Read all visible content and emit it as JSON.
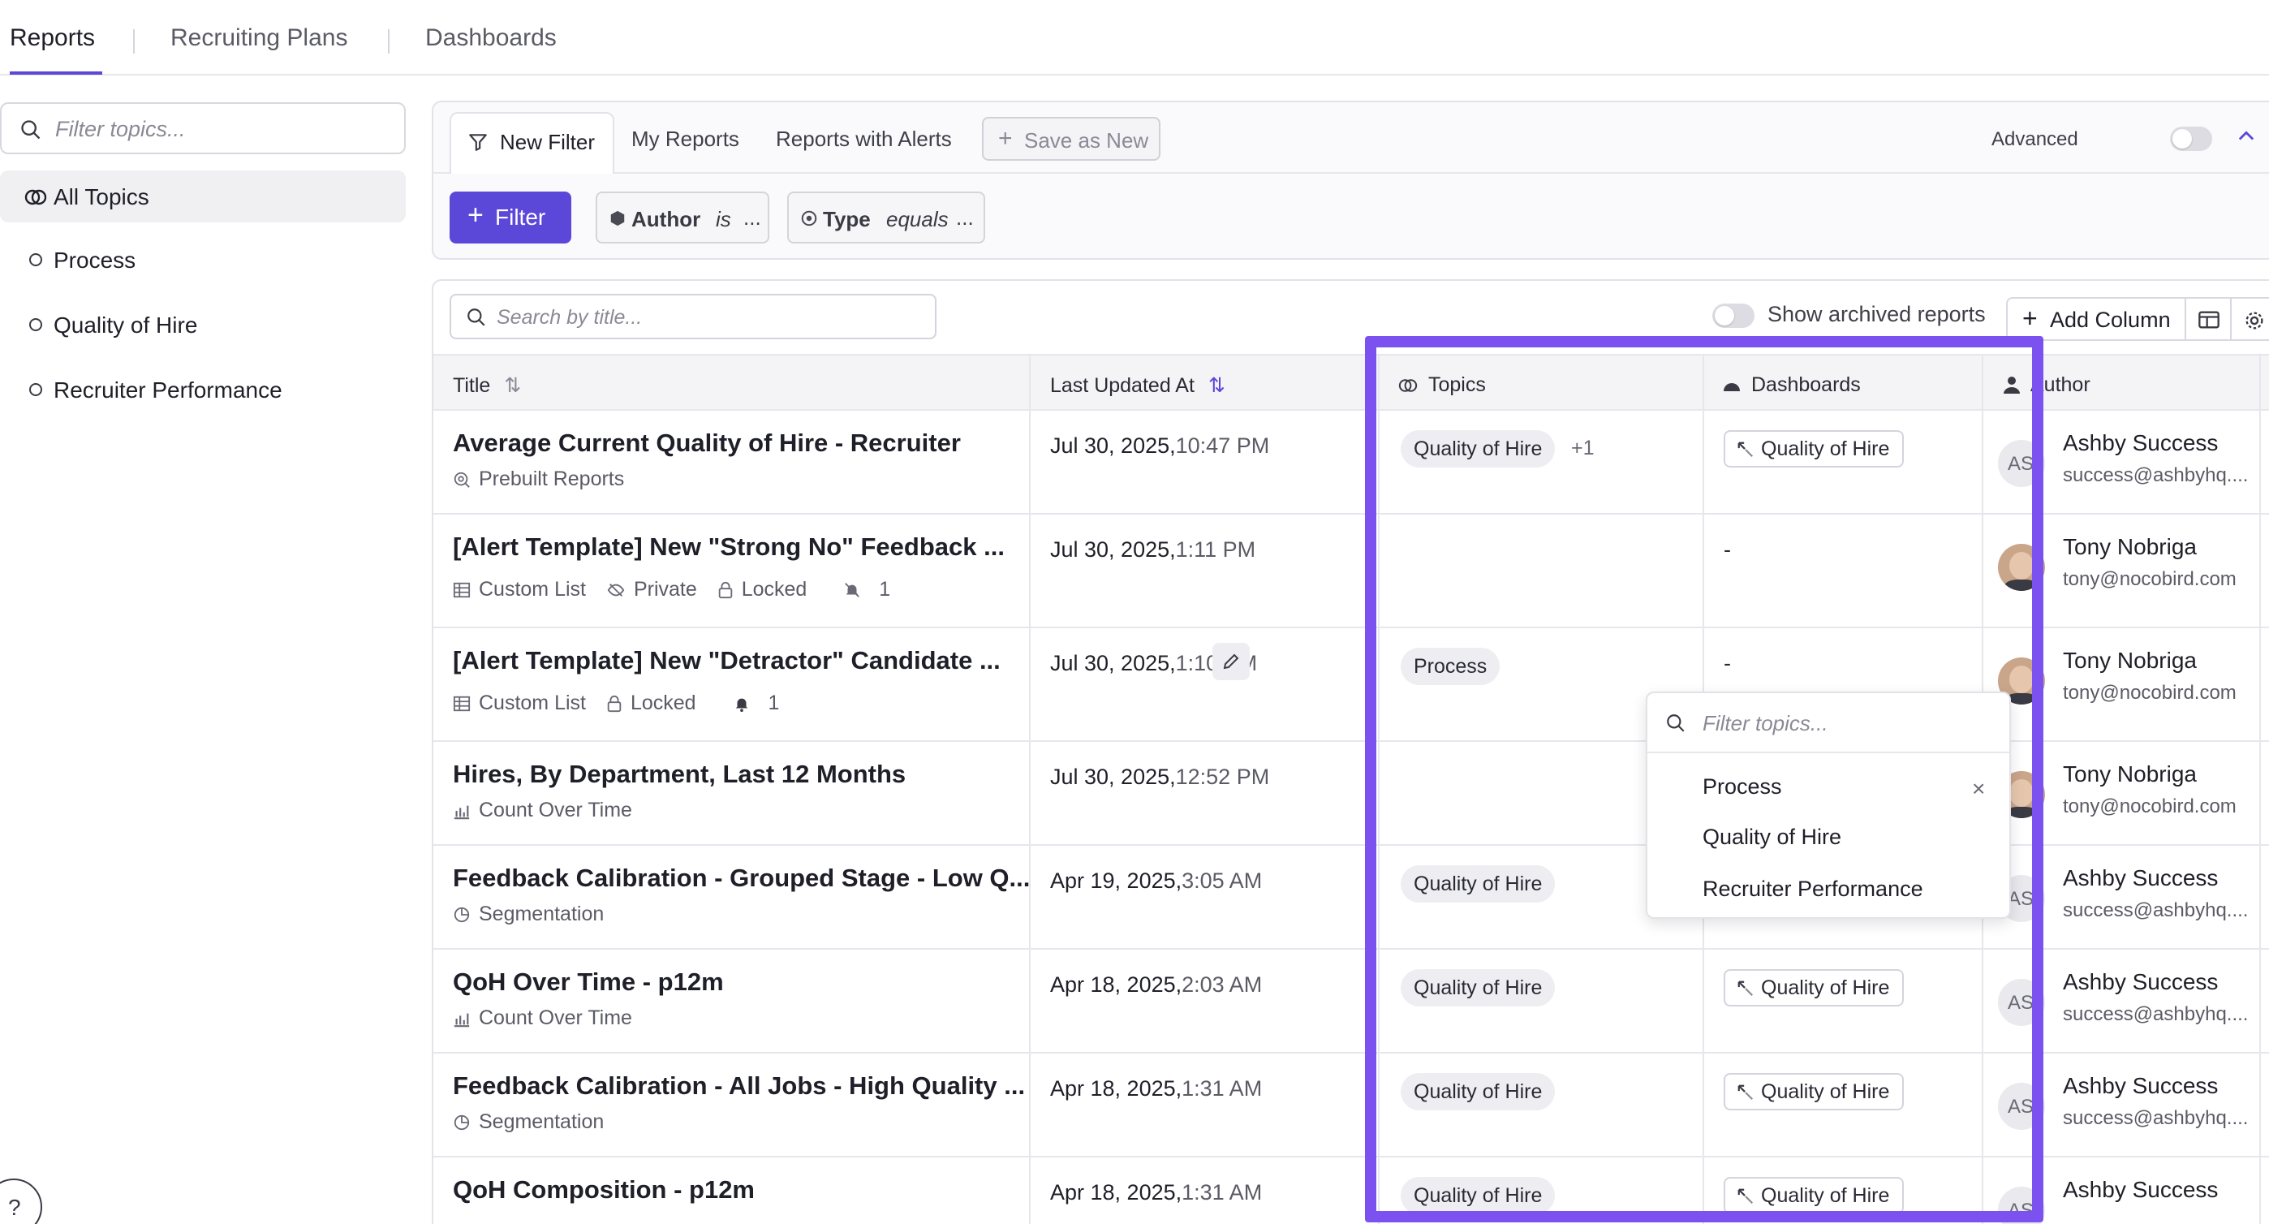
{
  "nav": {
    "tabs": [
      "Reports",
      "Recruiting Plans",
      "Dashboards"
    ]
  },
  "sidebar": {
    "search_placeholder": "Filter topics...",
    "items": [
      "All Topics",
      "Process",
      "Quality of Hire",
      "Recruiter Performance"
    ]
  },
  "filters": {
    "tabs": [
      "New Filter",
      "My Reports",
      "Reports with Alerts"
    ],
    "save_as_new": "Save as New",
    "advanced_label": "Advanced",
    "filter_button": "Filter",
    "chips": [
      {
        "key": "Author",
        "op": "is",
        "value": "..."
      },
      {
        "key": "Type",
        "op": "equals",
        "value": "..."
      }
    ]
  },
  "table": {
    "search_placeholder": "Search by title...",
    "show_archived": "Show archived reports",
    "add_column": "Add Column",
    "columns": [
      "Title",
      "Last Updated At",
      "Topics",
      "Dashboards",
      "Author"
    ],
    "rows": [
      {
        "title": "Average Current Quality of Hire - Recruiter",
        "meta": [
          "Prebuilt Reports"
        ],
        "date": "Jul 30, 2025,",
        "time": "10:47 PM",
        "topic": "Quality of Hire",
        "topic_more": "+1",
        "dashboard": "Quality of Hire",
        "author": "Ashby Success",
        "email": "success@ashbyhq....",
        "initials": "AS"
      },
      {
        "title": "[Alert Template] New \"Strong No\" Feedback ...",
        "meta": [
          "Custom List",
          "Private",
          "Locked",
          "1"
        ],
        "date": "Jul 30, 2025,",
        "time": "1:11 PM",
        "topic": "",
        "topic_more": "",
        "dashboard": "-",
        "author": "Tony Nobriga",
        "email": "tony@nocobird.com",
        "initials": ""
      },
      {
        "title": "[Alert Template] New \"Detractor\" Candidate ...",
        "meta": [
          "Custom List",
          "Locked",
          "1"
        ],
        "date": "Jul 30, 2025,",
        "time": "1:10 PM",
        "topic": "Process",
        "topic_more": "",
        "dashboard": "-",
        "author": "Tony Nobriga",
        "email": "tony@nocobird.com",
        "initials": ""
      },
      {
        "title": "Hires, By Department, Last 12 Months",
        "meta": [
          "Count Over Time"
        ],
        "date": "Jul 30, 2025,",
        "time": "12:52 PM",
        "topic": "",
        "topic_more": "",
        "dashboard": "",
        "author": "Tony Nobriga",
        "email": "tony@nocobird.com",
        "initials": ""
      },
      {
        "title": "Feedback Calibration - Grouped Stage - Low Q...",
        "meta": [
          "Segmentation"
        ],
        "date": "Apr 19, 2025,",
        "time": "3:05 AM",
        "topic": "Quality of Hire",
        "topic_more": "",
        "dashboard": "",
        "author": "Ashby Success",
        "email": "success@ashbyhq....",
        "initials": "AS"
      },
      {
        "title": "QoH Over Time - p12m",
        "meta": [
          "Count Over Time"
        ],
        "date": "Apr 18, 2025,",
        "time": "2:03 AM",
        "topic": "Quality of Hire",
        "topic_more": "",
        "dashboard": "Quality of Hire",
        "author": "Ashby Success",
        "email": "success@ashbyhq....",
        "initials": "AS"
      },
      {
        "title": "Feedback Calibration - All Jobs - High Quality ...",
        "meta": [
          "Segmentation"
        ],
        "date": "Apr 18, 2025,",
        "time": "1:31 AM",
        "topic": "Quality of Hire",
        "topic_more": "",
        "dashboard": "Quality of Hire",
        "author": "Ashby Success",
        "email": "success@ashbyhq....",
        "initials": "AS"
      },
      {
        "title": "QoH Composition - p12m",
        "meta": [],
        "date": "Apr 18, 2025,",
        "time": "1:31 AM",
        "topic": "Quality of Hire",
        "topic_more": "",
        "dashboard": "Quality of Hire",
        "author": "Ashby Success",
        "email": "",
        "initials": "AS"
      }
    ]
  },
  "dropdown": {
    "search_placeholder": "Filter topics...",
    "options": [
      "Process",
      "Quality of Hire",
      "Recruiter Performance"
    ]
  },
  "help_label": "?",
  "colors": {
    "accent": "#5b48d9",
    "highlight": "#7b52f0"
  }
}
